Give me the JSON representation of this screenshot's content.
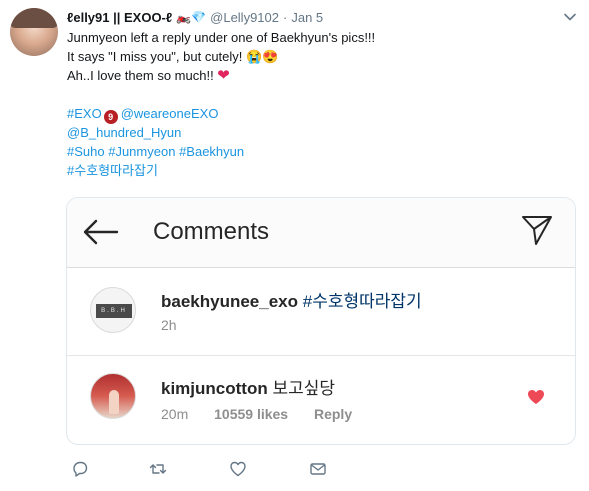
{
  "tweet": {
    "display_name": "ℓelly91 || EXOO-ℓ",
    "name_emojis": "🏍️💎",
    "handle": "@Lelly9102",
    "separator": "·",
    "date": "Jan 5",
    "lines": {
      "l1": "Junmyeon left a reply under one of Baekhyun's pics!!!",
      "l2": "It says \"I miss you\", but cutely! ",
      "l2_emoji": "😭😍",
      "l3": "Ah..I love them so much!! ",
      "l3_emoji": "❤"
    },
    "tags": {
      "exo": "#EXO",
      "exo_badge": "9",
      "weareone": "@weareoneEXO",
      "bhyun": "@B_hundred_Hyun",
      "suho": "#Suho",
      "junmyeon": "#Junmyeon",
      "baekhyun": "#Baekhyun",
      "korean": "#수호형따라잡기"
    },
    "link_color": "#1b95e0"
  },
  "screenshot_card": {
    "title": "Comments",
    "comments": [
      {
        "username": "baekhyunee_exo",
        "text": "#수호형따라잡기",
        "time": "2h",
        "avatar_text": "B.B.H"
      },
      {
        "username": "kimjuncotton",
        "text": "보고싶당",
        "time": "20m",
        "likes": "10559 likes",
        "reply": "Reply",
        "liked": true
      }
    ]
  },
  "actions": {
    "icons": [
      "reply-icon",
      "retweet-icon",
      "like-icon",
      "message-icon"
    ]
  }
}
